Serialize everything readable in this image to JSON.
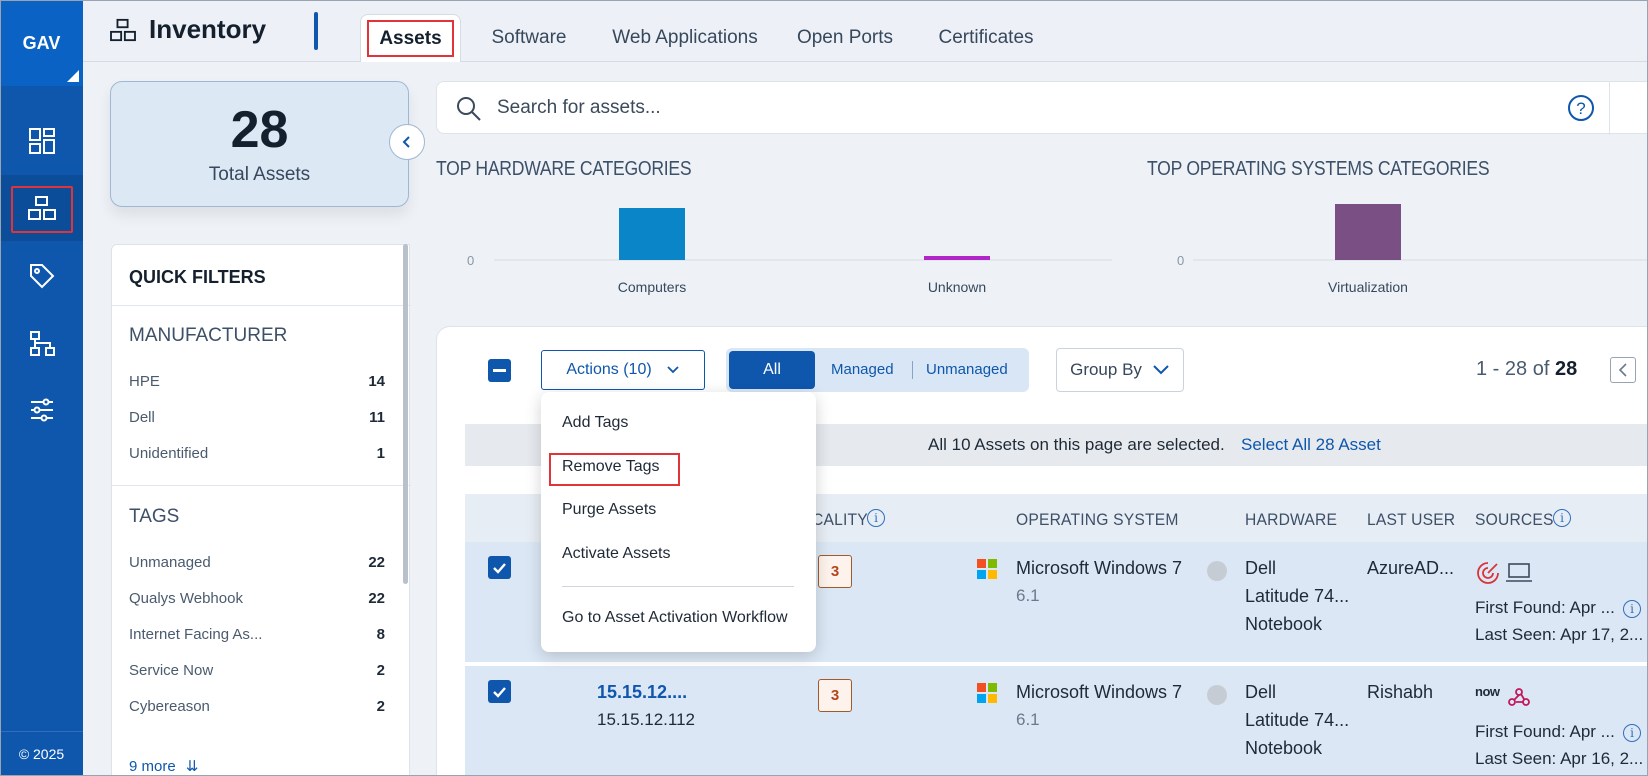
{
  "sidebar": {
    "logo": "GAV",
    "items": [
      {
        "name": "dashboard-icon"
      },
      {
        "name": "inventory-icon",
        "active": true
      },
      {
        "name": "tag-icon"
      },
      {
        "name": "network-icon"
      },
      {
        "name": "sliders-icon"
      }
    ],
    "copyright": "© 2025"
  },
  "header": {
    "title": "Inventory",
    "tabs": [
      {
        "label": "Assets",
        "active": true
      },
      {
        "label": "Software"
      },
      {
        "label": "Web Applications"
      },
      {
        "label": "Open Ports"
      },
      {
        "label": "Certificates"
      }
    ]
  },
  "summary": {
    "total": "28",
    "label": "Total Assets"
  },
  "search": {
    "placeholder": "Search for assets..."
  },
  "quick_filters": {
    "title": "QUICK FILTERS",
    "manufacturer": {
      "title": "MANUFACTURER",
      "items": [
        {
          "label": "HPE",
          "count": "14"
        },
        {
          "label": "Dell",
          "count": "11"
        },
        {
          "label": "Unidentified",
          "count": "1"
        }
      ]
    },
    "tags": {
      "title": "TAGS",
      "items": [
        {
          "label": "Unmanaged",
          "count": "22"
        },
        {
          "label": "Qualys Webhook",
          "count": "22"
        },
        {
          "label": "Internet Facing As...",
          "count": "8"
        },
        {
          "label": "Service Now",
          "count": "2"
        },
        {
          "label": "Cybereason",
          "count": "2"
        }
      ],
      "more": "9 more"
    }
  },
  "chart_data": [
    {
      "type": "bar",
      "title": "TOP HARDWARE CATEGORIES",
      "categories": [
        "Computers",
        "Unknown"
      ],
      "values": [
        26,
        2
      ],
      "y_tick_label": "0",
      "colors": [
        "#0a86c8",
        "#b026c9"
      ]
    },
    {
      "type": "bar",
      "title": "TOP OPERATING SYSTEMS CATEGORIES",
      "categories": [
        "Virtualization"
      ],
      "values": [
        28
      ],
      "y_tick_label": "0",
      "colors": [
        "#7a4f84"
      ]
    }
  ],
  "toolbar": {
    "actions_label": "Actions (10)",
    "filter_all": "All",
    "filter_managed": "Managed",
    "filter_unmanaged": "Unmanaged",
    "group_by": "Group By",
    "pager_range": "1 - 28 of",
    "pager_total": "28"
  },
  "actions_menu": {
    "items": [
      "Add Tags",
      "Remove Tags",
      "Purge Assets",
      "Activate Assets"
    ],
    "workflow": "Go to Asset Activation Workflow"
  },
  "selection": {
    "message": "All 10 Assets on this page are selected.",
    "select_all": "Select All 28 Asset"
  },
  "table": {
    "columns": {
      "criticality": "CALITY",
      "os": "OPERATING SYSTEM",
      "hardware": "HARDWARE",
      "last_user": "LAST USER",
      "sources": "SOURCES"
    },
    "rows": [
      {
        "name": "",
        "ip": "",
        "criticality": "3",
        "os": "Microsoft Windows 7",
        "os_version": "6.1",
        "hw1": "Dell",
        "hw2": "Latitude 74...",
        "hw3": "Notebook",
        "user": "AzureAD...",
        "first_found": "First Found: Apr ...",
        "last_seen": "Last Seen: Apr 17, 2..."
      },
      {
        "name": "15.15.12....",
        "ip": "15.15.12.112",
        "criticality": "3",
        "os": "Microsoft Windows 7",
        "os_version": "6.1",
        "hw1": "Dell",
        "hw2": "Latitude 74...",
        "hw3": "Notebook",
        "user": "Rishabh",
        "source_label": "now",
        "first_found": "First Found: Apr ...",
        "last_seen": "Last Seen: Apr 16, 2..."
      }
    ]
  },
  "colors": {
    "primary": "#0e57ad",
    "highlight": "#e0343a",
    "row_selected": "#dbe7f5"
  }
}
